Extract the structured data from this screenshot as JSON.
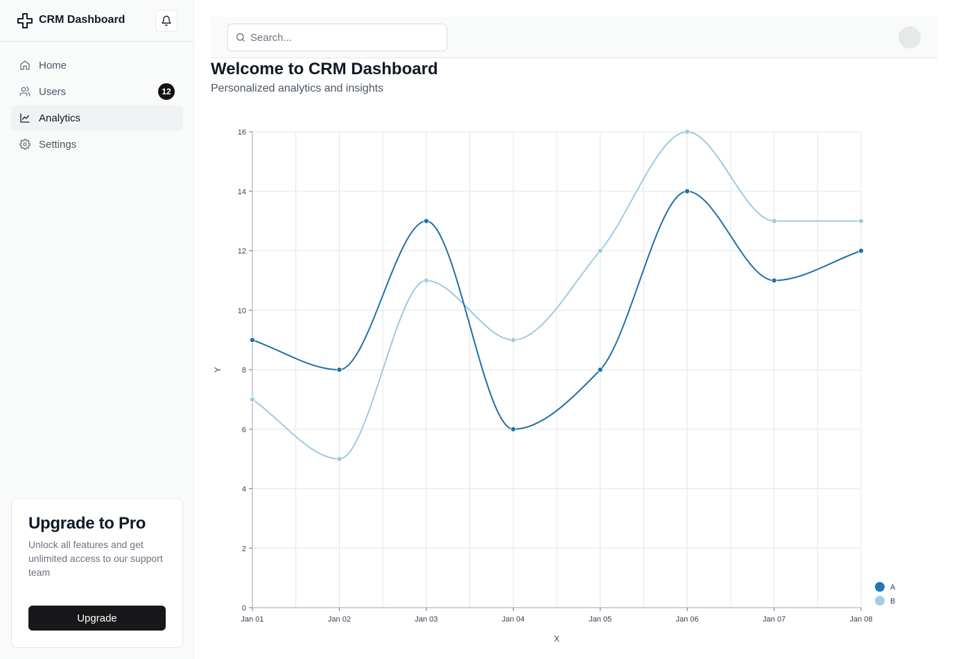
{
  "app": {
    "brand_title": "CRM Dashboard"
  },
  "sidebar": {
    "items": [
      {
        "label": "Home",
        "icon": "home-icon"
      },
      {
        "label": "Users",
        "icon": "users-icon",
        "badge": "12"
      },
      {
        "label": "Analytics",
        "icon": "chart-line-icon",
        "active": true
      },
      {
        "label": "Settings",
        "icon": "gear-icon"
      }
    ]
  },
  "upgrade": {
    "title": "Upgrade to Pro",
    "text": "Unlock all features and get unlimited access to our support team",
    "button_label": "Upgrade"
  },
  "header": {
    "search_placeholder": "Search..."
  },
  "main": {
    "title": "Welcome to CRM Dashboard",
    "subtitle": "Personalized analytics and insights"
  },
  "colors": {
    "series_a": "#1f6fa5",
    "series_b": "#9ec9e2",
    "legend_a": "#1f78b4",
    "legend_b": "#a6cee3"
  },
  "chart_data": {
    "type": "line",
    "x": [
      "Jan 01",
      "Jan 02",
      "Jan 03",
      "Jan 04",
      "Jan 05",
      "Jan 06",
      "Jan 07",
      "Jan 08"
    ],
    "series": [
      {
        "name": "A",
        "values": [
          9,
          8,
          13,
          6,
          8,
          14,
          11,
          12
        ]
      },
      {
        "name": "B",
        "values": [
          7,
          5,
          11,
          9,
          12,
          16,
          13,
          13
        ]
      }
    ],
    "title": "",
    "xlabel": "X",
    "ylabel": "Y",
    "ylim": [
      0,
      16
    ],
    "yticks": [
      0,
      2,
      4,
      6,
      8,
      10,
      12,
      14,
      16
    ],
    "grid": true,
    "legend_position": "bottom-right",
    "curve": "smooth"
  }
}
